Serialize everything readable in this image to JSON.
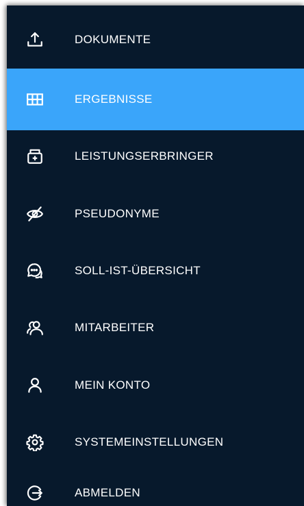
{
  "nav": {
    "items": [
      {
        "label": "DOKUMENTE",
        "icon": "upload-icon",
        "active": false
      },
      {
        "label": "ERGEBNISSE",
        "icon": "table-icon",
        "active": true
      },
      {
        "label": "LEISTUNGSERBRINGER",
        "icon": "medical-kit-icon",
        "active": false
      },
      {
        "label": "PSEUDONYME",
        "icon": "eye-off-icon",
        "active": false
      },
      {
        "label": "SOLL-IST-ÜBERSICHT",
        "icon": "chat-bubbles-icon",
        "active": false
      },
      {
        "label": "MITARBEITER",
        "icon": "users-icon",
        "active": false
      },
      {
        "label": "MEIN KONTO",
        "icon": "user-icon",
        "active": false
      },
      {
        "label": "SYSTEMEINSTELLUNGEN",
        "icon": "gear-icon",
        "active": false
      },
      {
        "label": "ABMELDEN",
        "icon": "logout-icon",
        "active": false
      }
    ]
  },
  "colors": {
    "background": "#07192c",
    "active": "#3aa5fa",
    "text": "#ffffff"
  }
}
